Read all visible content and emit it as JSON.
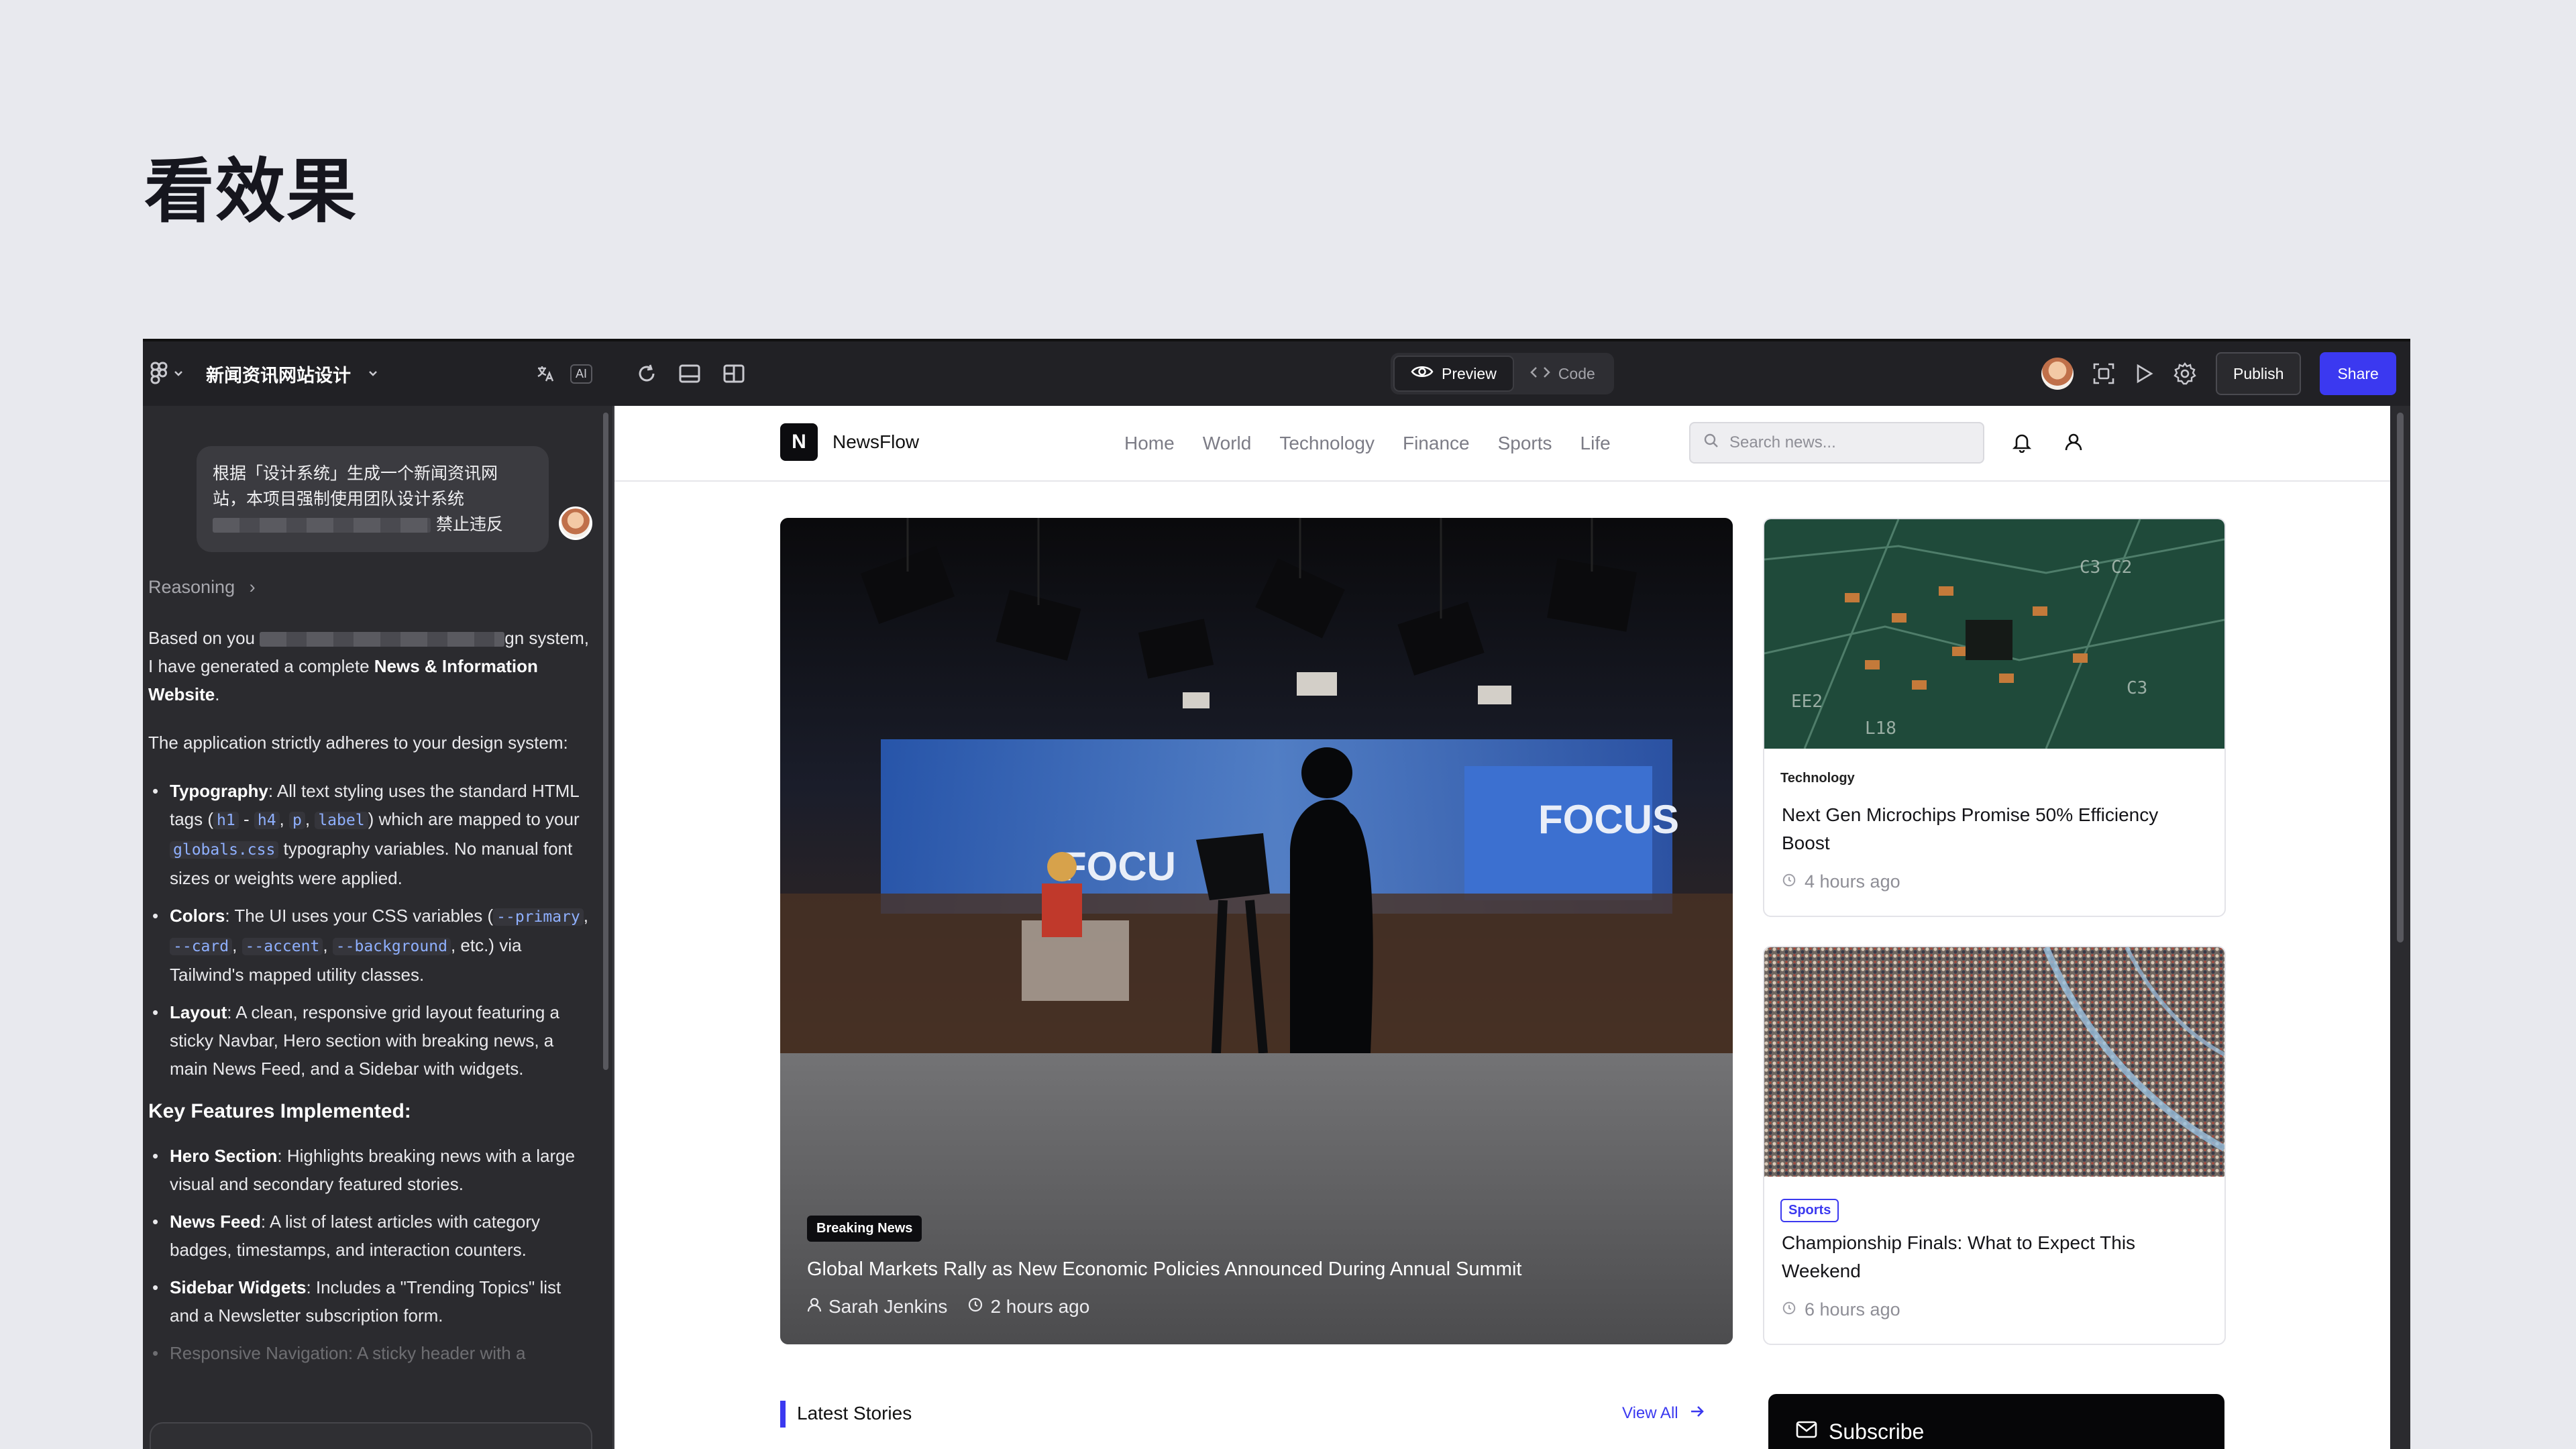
{
  "slide_title": "看效果",
  "app": {
    "project_name": "新闻资讯网站设计",
    "ai_label": "AI",
    "tabs": {
      "preview": "Preview",
      "code": "Code"
    },
    "publish": "Publish",
    "share": "Share"
  },
  "chat": {
    "user_msg_line1": "根据「设计系统」生成一个新闻资讯网",
    "user_msg_line2": "站，本项目强制使用团队设计系统",
    "user_msg_line3_tail": "禁止违反",
    "reasoning": "Reasoning",
    "p1_a": "Based on you",
    "p1_b": "gn system, I have generated a complete ",
    "p1_bold": "News & Information Website",
    "p1_end": ".",
    "p2": "The application strictly adheres to your design system:",
    "b1_bold": "Typography",
    "b1_a": ": All text styling uses the standard HTML tags (",
    "b1_c1": "h1",
    "b1_dash": " - ",
    "b1_c2": "h4",
    "b1_c3": "p",
    "b1_c4": "label",
    "b1_b": ") which are mapped to your ",
    "b1_c5": "globals.css",
    "b1_c": " typography variables. No manual font sizes or weights were applied.",
    "b2_bold": "Colors",
    "b2_a": ": The UI uses your CSS variables (",
    "b2_c1": "--primary",
    "b2_c2": "--card",
    "b2_c3": "--accent",
    "b2_c4": "--background",
    "b2_b": ", etc.) via Tailwind's mapped utility classes.",
    "b3_bold": "Layout",
    "b3_a": ": A clean, responsive grid layout featuring a sticky Navbar, Hero section with breaking news, a main News Feed, and a Sidebar with widgets.",
    "features_heading": "Key Features Implemented:",
    "f1_bold": "Hero Section",
    "f1": ": Highlights breaking news with a large visual and secondary featured stories.",
    "f2_bold": "News Feed",
    "f2": ": A list of latest articles with category badges, timestamps, and interaction counters.",
    "f3_bold": "Sidebar Widgets",
    "f3": ": Includes a \"Trending Topics\" list and a Newsletter subscription form.",
    "f4_partial": "Responsive Navigation: A sticky header with a"
  },
  "site": {
    "logo_mark": "N",
    "logo_text": "NewsFlow",
    "nav": [
      "Home",
      "World",
      "Technology",
      "Finance",
      "Sports",
      "Life"
    ],
    "search_placeholder": "Search news...",
    "hero": {
      "badge": "Breaking News",
      "title": "Global Markets Rally as New Economic Policies Announced During Annual Summit",
      "author": "Sarah Jenkins",
      "time": "2 hours ago"
    },
    "cards": [
      {
        "category": "Technology",
        "title": "Next Gen Microchips Promise 50% Efficiency Boost",
        "time": "4 hours ago"
      },
      {
        "category": "Sports",
        "title": "Championship Finals: What to Expect This Weekend",
        "time": "6 hours ago"
      }
    ],
    "latest": "Latest Stories",
    "view_all": "View All",
    "subscribe": "Subscribe"
  },
  "colors": {
    "accent": "#3b39f0",
    "dark": "#212125",
    "panel": "#2b2b2f"
  }
}
